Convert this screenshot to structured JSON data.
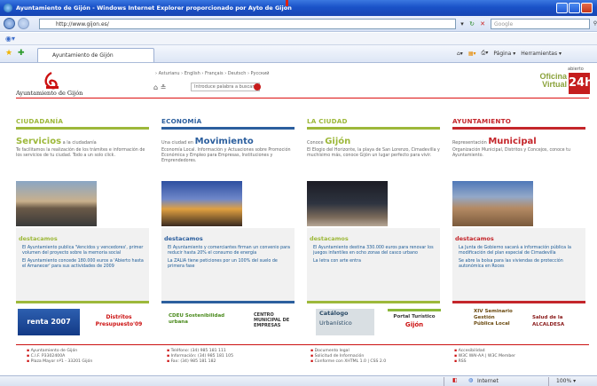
{
  "window": {
    "title": "Ayuntamiento de Gijón - Windows Internet Explorer proporcionado por Ayto de Gijón"
  },
  "address": {
    "url": "http://www.gijon.es/",
    "search_placeholder": "Google"
  },
  "tabbar": {
    "tab_label": "Ayuntamiento de Gijón",
    "pagina": "Página",
    "herramientas": "Herramientas"
  },
  "site": {
    "logo_text": "Ayuntamiento de Gijón",
    "languages": "› Asturianu  › English  › Français  › Deutsch  › Русский",
    "search_placeholder": "Introduce palabra a buscar",
    "oficina_1": "Oficina",
    "oficina_2": "Virtual",
    "abierto": "abierto",
    "badge": "24h."
  },
  "columns": [
    {
      "title": "CIUDADANÍA",
      "color": "#9db83a",
      "sub_big": "Servicios",
      "sub_small": "a la ciudadanía",
      "desc": "Te facilitamos la realización de los trámites e información de los servicios de tu ciudad. Todo a un solo click.",
      "dest": "destacamos",
      "links": [
        "El Ayuntamiento publica 'Vencidos y vencedores', primer volumen del proyecto sobre la memoria social",
        "El Ayuntamiento concede 180.000 euros a 'Abierto hasta el Amanecer' para sus actividades de 2009"
      ]
    },
    {
      "title": "ECONOMÍA",
      "color": "#2c5f9e",
      "sub_pre": "Una ciudad en",
      "sub_big": "Movimiento",
      "desc": "Economía Local. Información y Actuaciones sobre Promoción Económica y Empleo para Empresas, Instituciones y Emprendedores.",
      "dest": "destacamos",
      "links": [
        "El Ayuntamiento y comerciantes firman un convenio para reducir hasta 20% el consumo de energía",
        "La ZALIA tiene peticiones por un 100% del suelo de primera fase"
      ]
    },
    {
      "title": "LA CIUDAD",
      "color": "#9db83a",
      "sub_pre": "Conoce",
      "sub_big": "Gijón",
      "desc": "El Elogio del Horizonte, la playa de San Lorenzo, Cimadevilla y muchísimo más, conoce Gijón un lugar perfecto para vivir.",
      "dest": "destacamos",
      "links": [
        "El Ayuntamiento destina 330.000 euros para renovar los juegos infantiles en ocho zonas del casco urbano",
        "La letra con arte entra"
      ]
    },
    {
      "title": "AYUNTAMIENTO",
      "color": "#c4262b",
      "sub_pre": "Representación",
      "sub_big": "Municipal",
      "desc": "Organización Municipal, Distritos y Concejos, conoce tu Ayuntamiento.",
      "dest": "destacamos",
      "links": [
        "La Junta de Gobierno sacará a información pública la modificación del plan especial de Cimadevilla",
        "Se abre la bolsa para las viviendas de protección autonómica en Roces"
      ]
    }
  ],
  "banners": {
    "renta": "renta 2007",
    "distritos": "Distritos Presupuesto'09",
    "cdeu": "CDEU Sostenibilidad urbana",
    "centro": "CENTRO MUNICIPAL DE EMPRESAS",
    "catalogo_1": "Catálogo",
    "catalogo_2": "Urbanístico",
    "portal_1": "Portal Turístico",
    "portal_2": "Gijón",
    "seminario": "XIV Seminario Gestión Pública Local",
    "salud": "Salud de la ALCALDESA"
  },
  "footer": {
    "col1": [
      "Ayuntamiento de Gijón",
      "C.I.F. P3302400A",
      "Plaza Mayor nº1 - 33201 Gijón"
    ],
    "col2": [
      "Teléfono: (34) 985 181 111",
      "Información: (34) 985 181 105",
      "Fax: (34) 985 181 182"
    ],
    "col3": [
      "Documento legal",
      "Solicitud de Información",
      "Conforme con XHTML 1.0 | CSS 2.0"
    ],
    "col4": [
      "Accesibilidad",
      "W3C WAI-AA | W3C Member",
      "RSS"
    ]
  },
  "status": {
    "zone": "Internet",
    "zoom": "100%"
  }
}
